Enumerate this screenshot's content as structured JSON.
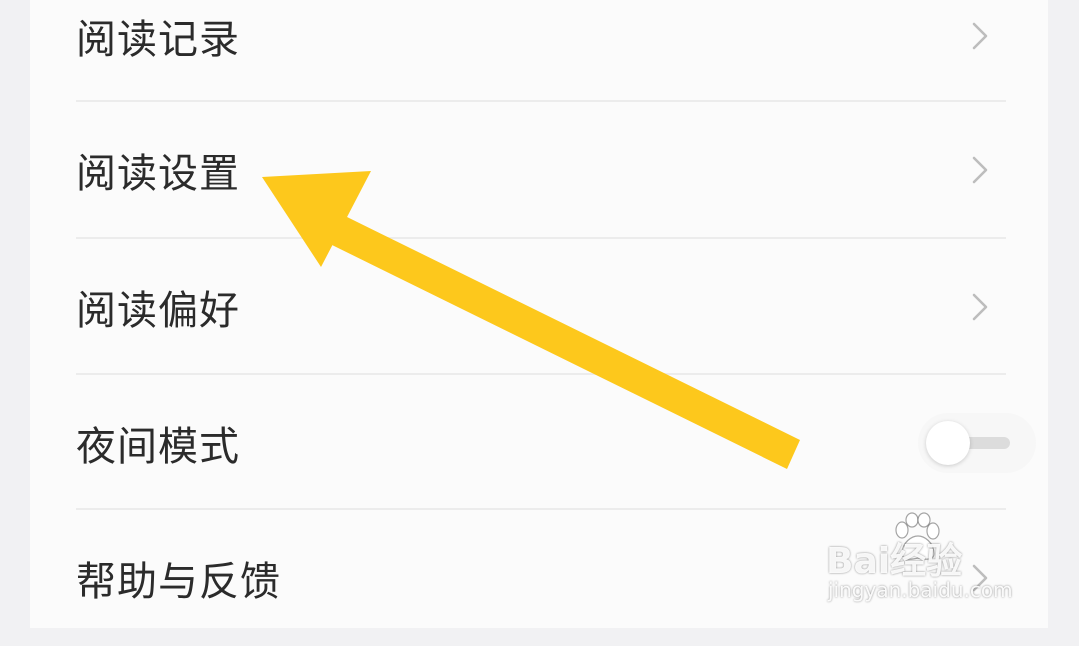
{
  "menu": {
    "items": [
      {
        "label": "阅读记录",
        "control": "chevron"
      },
      {
        "label": "阅读设置",
        "control": "chevron"
      },
      {
        "label": "阅读偏好",
        "control": "chevron"
      },
      {
        "label": "夜间模式",
        "control": "toggle",
        "toggle_on": false
      },
      {
        "label": "帮助与反馈",
        "control": "chevron"
      }
    ]
  },
  "annotation": {
    "arrow_color": "#fdc81c",
    "points_to": "阅读设置"
  },
  "watermark": {
    "brand": "Bai经验",
    "url": "jingyan.baidu.com"
  },
  "icons": {
    "chevron": "chevron-right-icon",
    "paw": "baidu-paw-icon"
  },
  "colors": {
    "background": "#f1f1f3",
    "card": "#fbfbfb",
    "text": "#2b2b2b",
    "divider": "#ececec",
    "chevron": "#bdbdbd"
  }
}
